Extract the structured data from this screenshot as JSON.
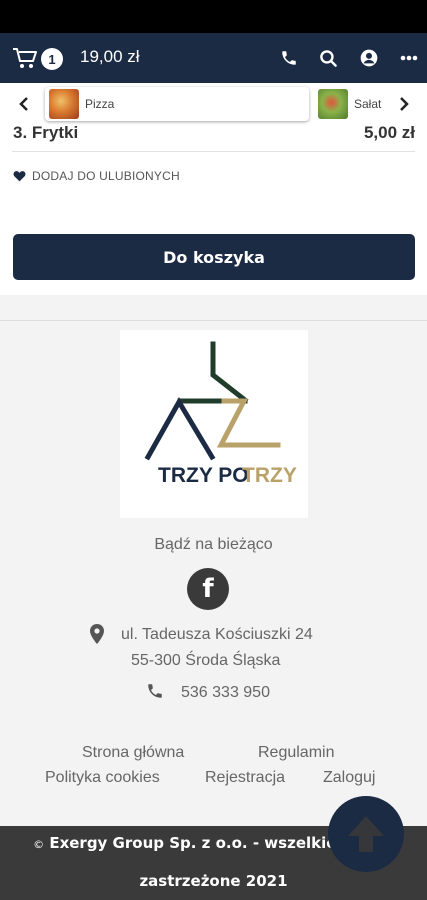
{
  "header": {
    "cart_count": "1",
    "cart_total": "19,00 zł",
    "icons": [
      "cart-icon",
      "phone-icon",
      "search-icon",
      "user-icon",
      "more-icon"
    ]
  },
  "categories": {
    "items": [
      {
        "label": "Pizza",
        "thumb_color": "#c4552a"
      },
      {
        "label": "Sałat",
        "thumb_color": "#6a9a3a"
      }
    ]
  },
  "product": {
    "name": "3. Frytki",
    "price": "5,00 zł",
    "favorite_label": "DODAJ DO ULUBIONYCH",
    "add_to_cart_label": "Do koszyka"
  },
  "footer": {
    "logo_text_1": "TRZY PO",
    "logo_text_2": "TRZY",
    "stay_updated": "Bądź na bieżąco",
    "facebook_glyph": "f",
    "address_line1": "ul. Tadeusza Kościuszki 24",
    "address_line2": "55-300 Środa Śląska",
    "phone": "536 333 950",
    "links": {
      "home": "Strona główna",
      "terms": "Regulamin",
      "cookies": "Polityka cookies",
      "register": "Rejestracja",
      "login": "Zaloguj"
    },
    "copyright_line1": "Exergy Group Sp. z o.o. - wszelkie prawa",
    "copyright_line2": "zastrzeżone 2021"
  },
  "colors": {
    "navy": "#1c2b44",
    "logo_green": "#1f3d2a",
    "logo_gold": "#b9a26a"
  }
}
